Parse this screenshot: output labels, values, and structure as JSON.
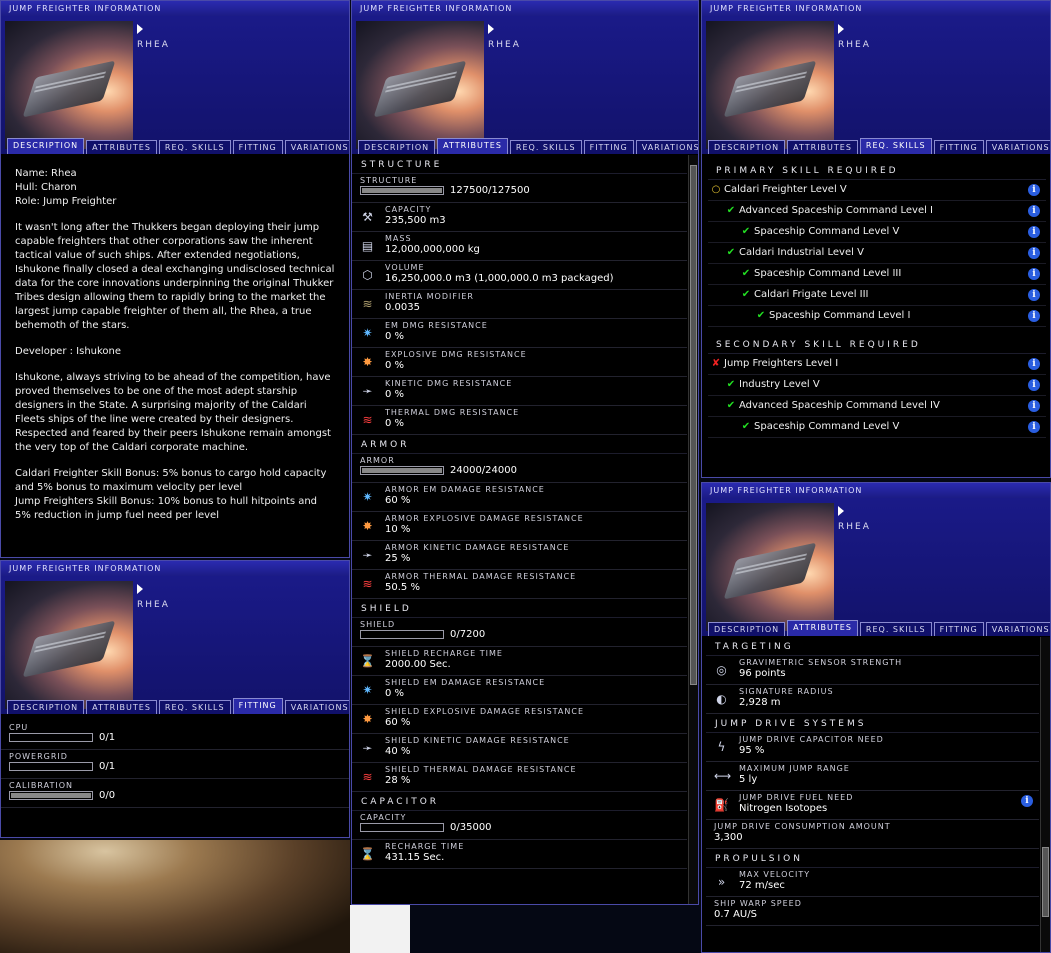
{
  "window_title": "JUMP FREIGHTER INFORMATION",
  "ship_name": "RHEA",
  "tabs": [
    "DESCRIPTION",
    "ATTRIBUTES",
    "REQ. SKILLS",
    "FITTING",
    "VARIATIONS"
  ],
  "description": {
    "lines": [
      "Name: Rhea",
      "Hull: Charon",
      "Role: Jump Freighter"
    ],
    "para1": "It wasn't long after the Thukkers began deploying their jump capable freighters that other corporations saw the inherent tactical value of such ships. After extended negotiations, Ishukone finally closed a deal exchanging undisclosed technical data for the core innovations underpinning the original Thukker Tribes design allowing them to rapidly bring to the market the largest jump capable freighter of them all, the Rhea, a true behemoth of the stars.",
    "developer": "Developer : Ishukone",
    "para2": "Ishukone, always striving to be ahead of the competition, have proved themselves to be one of the most adept starship designers in the State. A surprising majority of the Caldari Fleets ships of the line were created by their designers. Respected and feared by their peers Ishukone remain amongst the very top of the Caldari corporate machine.",
    "bonus1": "Caldari Freighter Skill Bonus: 5% bonus to cargo hold capacity and 5% bonus to maximum velocity per level",
    "bonus2": "Jump Freighters Skill Bonus: 10% bonus to hull hitpoints and 5% reduction in jump fuel need per level"
  },
  "attributes": {
    "structure_title": "STRUCTURE",
    "structure_label": "STRUCTURE",
    "structure_value": "127500/127500",
    "structure_fill": 1,
    "capacity": {
      "label": "CAPACITY",
      "value": "235,500 m3"
    },
    "mass": {
      "label": "MASS",
      "value": "12,000,000,000 kg"
    },
    "volume": {
      "label": "VOLUME",
      "value": "16,250,000.0 m3 (1,000,000.0 m3 packaged)"
    },
    "inertia": {
      "label": "INERTIA MODIFIER",
      "value": "0.0035"
    },
    "em": {
      "label": "EM DMG RESISTANCE",
      "value": "0 %"
    },
    "explosive": {
      "label": "EXPLOSIVE DMG RESISTANCE",
      "value": "0 %"
    },
    "kinetic": {
      "label": "KINETIC DMG RESISTANCE",
      "value": "0 %"
    },
    "thermal": {
      "label": "THERMAL DMG RESISTANCE",
      "value": "0 %"
    },
    "armor_title": "ARMOR",
    "armor_label": "ARMOR",
    "armor_value": "24000/24000",
    "armor_fill": 1,
    "armor_em": {
      "label": "ARMOR EM DAMAGE RESISTANCE",
      "value": "60 %"
    },
    "armor_explosive": {
      "label": "ARMOR EXPLOSIVE DAMAGE RESISTANCE",
      "value": "10 %"
    },
    "armor_kinetic": {
      "label": "ARMOR KINETIC DAMAGE RESISTANCE",
      "value": "25 %"
    },
    "armor_thermal": {
      "label": "ARMOR THERMAL DAMAGE RESISTANCE",
      "value": "50.5 %"
    },
    "shield_title": "SHIELD",
    "shield_label": "SHIELD",
    "shield_value": "0/7200",
    "shield_fill": 0,
    "shield_recharge": {
      "label": "SHIELD RECHARGE TIME",
      "value": "2000.00 Sec."
    },
    "shield_em": {
      "label": "SHIELD EM DAMAGE RESISTANCE",
      "value": "0 %"
    },
    "shield_explosive": {
      "label": "SHIELD EXPLOSIVE DAMAGE RESISTANCE",
      "value": "60 %"
    },
    "shield_kinetic": {
      "label": "SHIELD KINETIC DAMAGE RESISTANCE",
      "value": "40 %"
    },
    "shield_thermal": {
      "label": "SHIELD THERMAL DAMAGE RESISTANCE",
      "value": "28 %"
    },
    "capacitor_title": "CAPACITOR",
    "capacitor_label": "CAPACITY",
    "capacitor_value": "0/35000",
    "capacitor_fill": 0,
    "recharge": {
      "label": "RECHARGE TIME",
      "value": "431.15 Sec."
    }
  },
  "skills": {
    "primary_title": "PRIMARY SKILL REQUIRED",
    "primary": [
      {
        "name": "Caldari Freighter Level V",
        "status": "ring"
      },
      {
        "name": "Advanced Spaceship Command Level I",
        "status": "check"
      },
      {
        "name": "Spaceship Command Level V",
        "status": "check"
      },
      {
        "name": "Caldari Industrial Level V",
        "status": "check"
      },
      {
        "name": "Spaceship Command Level III",
        "status": "check"
      },
      {
        "name": "Caldari Frigate Level III",
        "status": "check"
      },
      {
        "name": "Spaceship Command Level I",
        "status": "check"
      }
    ],
    "secondary_title": "SECONDARY SKILL REQUIRED",
    "secondary": [
      {
        "name": "Jump Freighters Level I",
        "status": "x"
      },
      {
        "name": "Industry Level V",
        "status": "check"
      },
      {
        "name": "Advanced Spaceship Command Level IV",
        "status": "check"
      },
      {
        "name": "Spaceship Command Level V",
        "status": "check"
      }
    ]
  },
  "fitting": {
    "cpu": {
      "label": "CPU",
      "value": "0/1",
      "fill": 0
    },
    "powergrid": {
      "label": "POWERGRID",
      "value": "0/1",
      "fill": 0
    },
    "calibration": {
      "label": "CALIBRATION",
      "value": "0/0",
      "fill": 1
    }
  },
  "attributes2": {
    "targeting_title": "TARGETING",
    "grav": {
      "label": "GRAVIMETRIC SENSOR STRENGTH",
      "value": "96 points"
    },
    "sig": {
      "label": "SIGNATURE RADIUS",
      "value": "2,928 m"
    },
    "jump_title": "JUMP DRIVE SYSTEMS",
    "jcap": {
      "label": "JUMP DRIVE CAPACITOR NEED",
      "value": "95 %"
    },
    "jrange": {
      "label": "MAXIMUM JUMP RANGE",
      "value": "5 ly"
    },
    "jfuel": {
      "label": "JUMP DRIVE FUEL NEED",
      "value": "Nitrogen Isotopes"
    },
    "jcons": {
      "label": "JUMP DRIVE CONSUMPTION AMOUNT",
      "value": "3,300"
    },
    "prop_title": "PROPULSION",
    "vel": {
      "label": "MAX VELOCITY",
      "value": "72 m/sec"
    },
    "warp": {
      "label": "SHIP WARP SPEED",
      "value": "0.7 AU/S"
    }
  }
}
